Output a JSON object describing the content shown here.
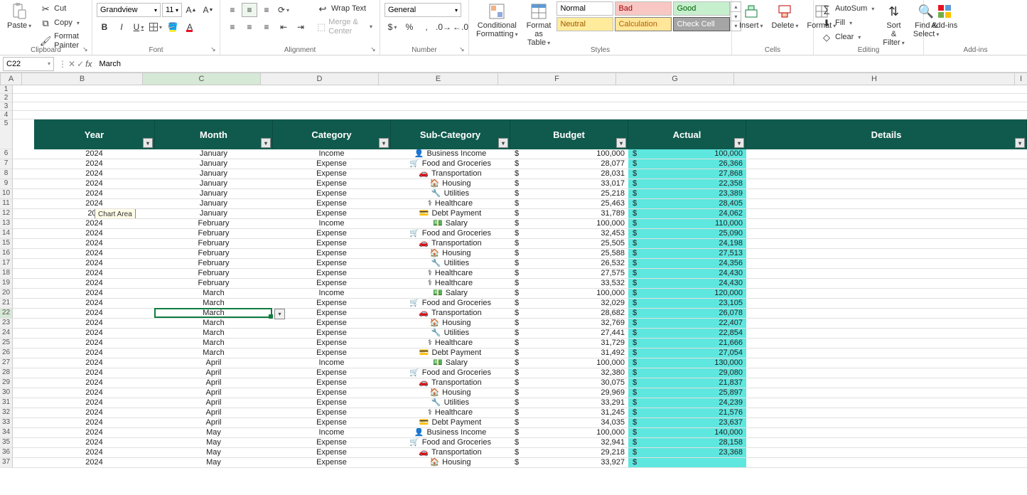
{
  "ribbon": {
    "clipboard": {
      "paste": "Paste",
      "cut": "Cut",
      "copy": "Copy",
      "format_painter": "Format Painter",
      "group_label": "Clipboard"
    },
    "font": {
      "name": "Grandview",
      "size": "11",
      "group_label": "Font"
    },
    "alignment": {
      "wrap_text": "Wrap Text",
      "merge_center": "Merge & Center",
      "group_label": "Alignment"
    },
    "number": {
      "format": "General",
      "group_label": "Number"
    },
    "styles": {
      "conditional": "Conditional\nFormatting",
      "format_table": "Format as\nTable",
      "normal": "Normal",
      "bad": "Bad",
      "good": "Good",
      "neutral": "Neutral",
      "calculation": "Calculation",
      "check_cell": "Check Cell",
      "group_label": "Styles"
    },
    "cells": {
      "insert": "Insert",
      "delete": "Delete",
      "format": "Format",
      "group_label": "Cells"
    },
    "editing": {
      "autosum": "AutoSum",
      "fill": "Fill",
      "clear": "Clear",
      "sort_filter": "Sort &\nFilter",
      "find_select": "Find &\nSelect",
      "group_label": "Editing"
    },
    "addins": {
      "label": "Add-ins",
      "group_label": "Add-ins"
    }
  },
  "name_box": "C22",
  "formula_value": "March",
  "columns": [
    "A",
    "B",
    "C",
    "D",
    "E",
    "F",
    "G",
    "H"
  ],
  "selected_col_idx": 2,
  "selected_row_num": 22,
  "table_headers": [
    "Year",
    "Month",
    "Category",
    "Sub-Category",
    "Budget",
    "Actual",
    "Details"
  ],
  "tooltip": "Chart Area",
  "rows": [
    {
      "n": 6,
      "year": "2024",
      "month": "January",
      "cat": "Income",
      "sub": "Business Income",
      "icon": "👤",
      "budget": "100,000",
      "actual": "100,000"
    },
    {
      "n": 7,
      "year": "2024",
      "month": "January",
      "cat": "Expense",
      "sub": "Food and Groceries",
      "icon": "🛒",
      "budget": "28,077",
      "actual": "26,366"
    },
    {
      "n": 8,
      "year": "2024",
      "month": "January",
      "cat": "Expense",
      "sub": "Transportation",
      "icon": "🚗",
      "budget": "28,031",
      "actual": "27,868"
    },
    {
      "n": 9,
      "year": "2024",
      "month": "January",
      "cat": "Expense",
      "sub": "Housing",
      "icon": "🏠",
      "budget": "33,017",
      "actual": "22,358"
    },
    {
      "n": 10,
      "year": "2024",
      "month": "January",
      "cat": "Expense",
      "sub": "Utilities",
      "icon": "🔧",
      "budget": "25,218",
      "actual": "23,389"
    },
    {
      "n": 11,
      "year": "2024",
      "month": "January",
      "cat": "Expense",
      "sub": "Healthcare",
      "icon": "⚕",
      "budget": "25,463",
      "actual": "28,405"
    },
    {
      "n": 12,
      "year": "202",
      "month": "January",
      "cat": "Expense",
      "sub": "Debt Payment",
      "icon": "💳",
      "budget": "31,789",
      "actual": "24,062",
      "tooltip": true
    },
    {
      "n": 13,
      "year": "2024",
      "month": "February",
      "cat": "Income",
      "sub": "Salary",
      "icon": "💵",
      "budget": "100,000",
      "actual": "110,000"
    },
    {
      "n": 14,
      "year": "2024",
      "month": "February",
      "cat": "Expense",
      "sub": "Food and Groceries",
      "icon": "🛒",
      "budget": "32,453",
      "actual": "25,090"
    },
    {
      "n": 15,
      "year": "2024",
      "month": "February",
      "cat": "Expense",
      "sub": "Transportation",
      "icon": "🚗",
      "budget": "25,505",
      "actual": "24,198"
    },
    {
      "n": 16,
      "year": "2024",
      "month": "February",
      "cat": "Expense",
      "sub": "Housing",
      "icon": "🏠",
      "budget": "25,588",
      "actual": "27,513"
    },
    {
      "n": 17,
      "year": "2024",
      "month": "February",
      "cat": "Expense",
      "sub": "Utilities",
      "icon": "🔧",
      "budget": "26,532",
      "actual": "24,356"
    },
    {
      "n": 18,
      "year": "2024",
      "month": "February",
      "cat": "Expense",
      "sub": "Healthcare",
      "icon": "⚕",
      "budget": "27,575",
      "actual": "24,430"
    },
    {
      "n": 19,
      "year": "2024",
      "month": "February",
      "cat": "Expense",
      "sub": "Healthcare",
      "icon": "⚕",
      "budget": "33,532",
      "actual": "24,430"
    },
    {
      "n": 20,
      "year": "2024",
      "month": "March",
      "cat": "Income",
      "sub": "Salary",
      "icon": "💵",
      "budget": "100,000",
      "actual": "120,000"
    },
    {
      "n": 21,
      "year": "2024",
      "month": "March",
      "cat": "Expense",
      "sub": "Food and Groceries",
      "icon": "🛒",
      "budget": "32,029",
      "actual": "23,105"
    },
    {
      "n": 22,
      "year": "2024",
      "month": "March",
      "cat": "Expense",
      "sub": "Transportation",
      "icon": "🚗",
      "budget": "28,682",
      "actual": "26,078",
      "active": true
    },
    {
      "n": 23,
      "year": "2024",
      "month": "March",
      "cat": "Expense",
      "sub": "Housing",
      "icon": "🏠",
      "budget": "32,769",
      "actual": "22,407"
    },
    {
      "n": 24,
      "year": "2024",
      "month": "March",
      "cat": "Expense",
      "sub": "Utilities",
      "icon": "🔧",
      "budget": "27,441",
      "actual": "22,854"
    },
    {
      "n": 25,
      "year": "2024",
      "month": "March",
      "cat": "Expense",
      "sub": "Healthcare",
      "icon": "⚕",
      "budget": "31,729",
      "actual": "21,666"
    },
    {
      "n": 26,
      "year": "2024",
      "month": "March",
      "cat": "Expense",
      "sub": "Debt Payment",
      "icon": "💳",
      "budget": "31,492",
      "actual": "27,054"
    },
    {
      "n": 27,
      "year": "2024",
      "month": "April",
      "cat": "Income",
      "sub": "Salary",
      "icon": "💵",
      "budget": "100,000",
      "actual": "130,000"
    },
    {
      "n": 28,
      "year": "2024",
      "month": "April",
      "cat": "Expense",
      "sub": "Food and Groceries",
      "icon": "🛒",
      "budget": "32,380",
      "actual": "29,080"
    },
    {
      "n": 29,
      "year": "2024",
      "month": "April",
      "cat": "Expense",
      "sub": "Transportation",
      "icon": "🚗",
      "budget": "30,075",
      "actual": "21,837"
    },
    {
      "n": 30,
      "year": "2024",
      "month": "April",
      "cat": "Expense",
      "sub": "Housing",
      "icon": "🏠",
      "budget": "29,969",
      "actual": "25,897"
    },
    {
      "n": 31,
      "year": "2024",
      "month": "April",
      "cat": "Expense",
      "sub": "Utilities",
      "icon": "🔧",
      "budget": "33,291",
      "actual": "24,239"
    },
    {
      "n": 32,
      "year": "2024",
      "month": "April",
      "cat": "Expense",
      "sub": "Healthcare",
      "icon": "⚕",
      "budget": "31,245",
      "actual": "21,576"
    },
    {
      "n": 33,
      "year": "2024",
      "month": "April",
      "cat": "Expense",
      "sub": "Debt Payment",
      "icon": "💳",
      "budget": "34,035",
      "actual": "23,637"
    },
    {
      "n": 34,
      "year": "2024",
      "month": "May",
      "cat": "Income",
      "sub": "Business Income",
      "icon": "👤",
      "budget": "100,000",
      "actual": "140,000"
    },
    {
      "n": 35,
      "year": "2024",
      "month": "May",
      "cat": "Expense",
      "sub": "Food and Groceries",
      "icon": "🛒",
      "budget": "32,941",
      "actual": "28,158"
    },
    {
      "n": 36,
      "year": "2024",
      "month": "May",
      "cat": "Expense",
      "sub": "Transportation",
      "icon": "🚗",
      "budget": "29,218",
      "actual": "23,368"
    },
    {
      "n": 37,
      "year": "2024",
      "month": "May",
      "cat": "Expense",
      "sub": "Housing",
      "icon": "🏠",
      "budget": "33,927",
      "actual": ""
    }
  ]
}
